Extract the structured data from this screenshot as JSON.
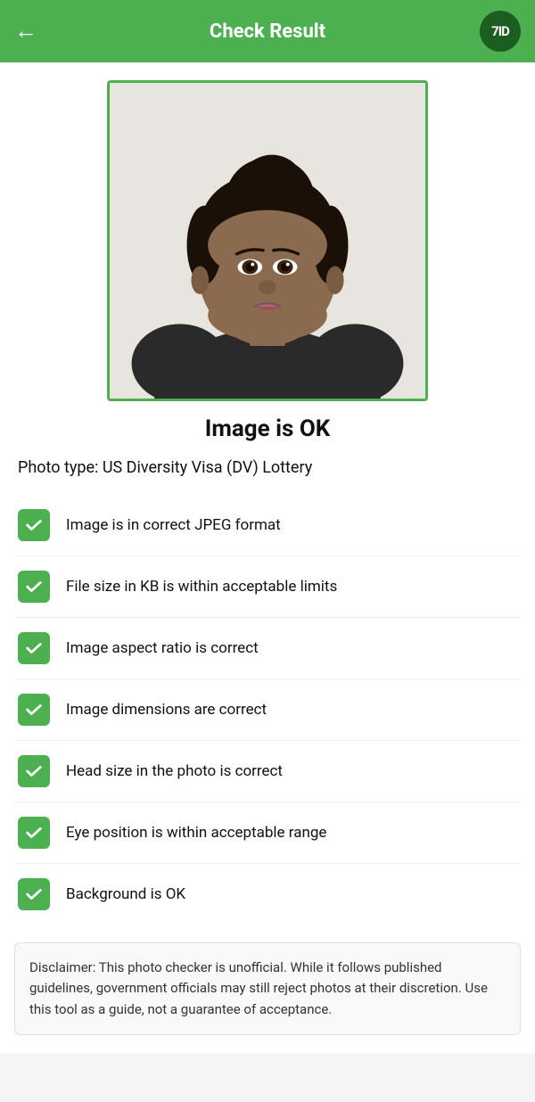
{
  "header": {
    "title": "Check Result",
    "back_arrow": "←",
    "logo_text": "7ID"
  },
  "photo": {
    "alt": "Passport photo of a young woman with dark hair in updo, wearing dark top"
  },
  "result": {
    "title": "Image is OK",
    "photo_type_label": "Photo type: US Diversity Visa (DV) Lottery"
  },
  "checks": [
    {
      "id": "jpeg",
      "label": "Image is in correct JPEG format",
      "passed": true
    },
    {
      "id": "filesize",
      "label": "File size in KB is within acceptable limits",
      "passed": true
    },
    {
      "id": "aspect",
      "label": "Image aspect ratio is correct",
      "passed": true
    },
    {
      "id": "dimensions",
      "label": "Image dimensions are correct",
      "passed": true
    },
    {
      "id": "headsize",
      "label": "Head size in the photo is correct",
      "passed": true
    },
    {
      "id": "eyepos",
      "label": "Eye position is within acceptable range",
      "passed": true
    },
    {
      "id": "background",
      "label": "Background is OK",
      "passed": true
    }
  ],
  "disclaimer": {
    "text": "Disclaimer: This photo checker is unofficial. While it follows published guidelines, government officials may still reject photos at their discretion. Use this tool as a guide, not a guarantee of acceptance."
  }
}
